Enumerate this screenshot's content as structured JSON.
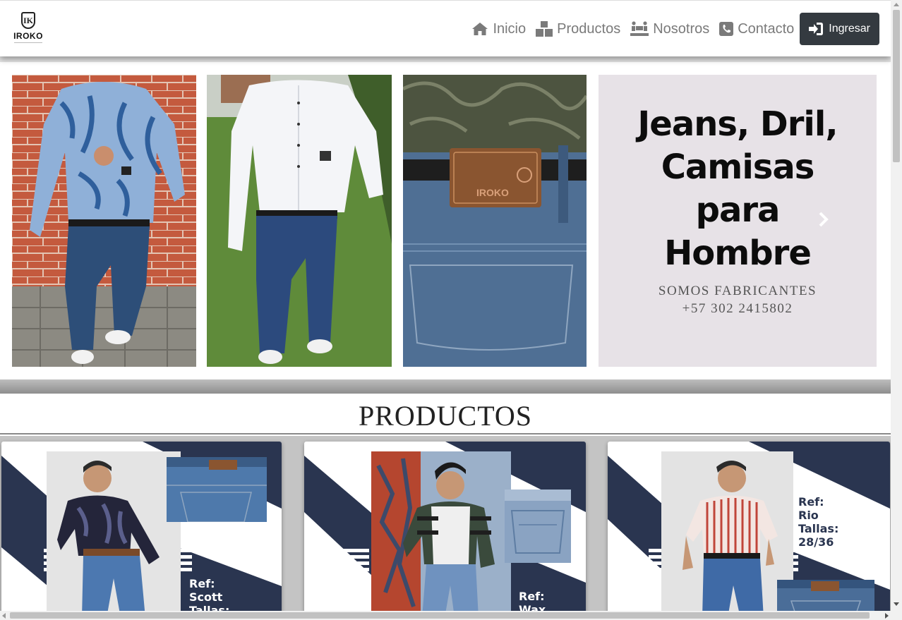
{
  "brand": {
    "logo_mark": "IK",
    "logo_text": "IROKO"
  },
  "nav": {
    "items": [
      {
        "label": "Inicio",
        "icon": "home-icon"
      },
      {
        "label": "Productos",
        "icon": "boxes-icon"
      },
      {
        "label": "Nosotros",
        "icon": "people-carry-icon"
      },
      {
        "label": "Contacto",
        "icon": "phone-icon"
      }
    ],
    "login_label": "Ingresar"
  },
  "carousel": {
    "promo_title_lines": [
      "Jeans, Dril,",
      "Camisas",
      "para",
      "Hombre"
    ],
    "promo_subtitle": "SOMOS FABRICANTES",
    "promo_phone": "+57 302 2415802",
    "patch_text": "IROKO"
  },
  "products_section": {
    "title": "PRODUCTOS",
    "cards": [
      {
        "ref": "Ref:",
        "name": "Scott",
        "sizes": "Tallas:"
      },
      {
        "ref": "Ref:",
        "name": "Wax",
        "sizes": ""
      },
      {
        "ref": "Ref:",
        "name": "Rio",
        "sizes": "Tallas:",
        "size_range": "28/36"
      }
    ]
  },
  "colors": {
    "navbar_button": "#343a40",
    "card_navy": "#2a3550",
    "promo_bg": "#e7e2e7",
    "nav_text": "#7a7a7a"
  }
}
